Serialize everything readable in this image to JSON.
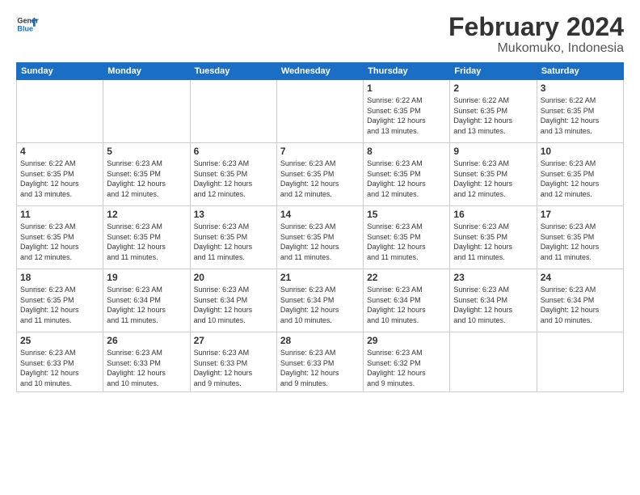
{
  "header": {
    "logo_line1": "General",
    "logo_line2": "Blue",
    "title": "February 2024",
    "subtitle": "Mukomuko, Indonesia"
  },
  "weekdays": [
    "Sunday",
    "Monday",
    "Tuesday",
    "Wednesday",
    "Thursday",
    "Friday",
    "Saturday"
  ],
  "weeks": [
    [
      {
        "day": "",
        "info": ""
      },
      {
        "day": "",
        "info": ""
      },
      {
        "day": "",
        "info": ""
      },
      {
        "day": "",
        "info": ""
      },
      {
        "day": "1",
        "info": "Sunrise: 6:22 AM\nSunset: 6:35 PM\nDaylight: 12 hours\nand 13 minutes."
      },
      {
        "day": "2",
        "info": "Sunrise: 6:22 AM\nSunset: 6:35 PM\nDaylight: 12 hours\nand 13 minutes."
      },
      {
        "day": "3",
        "info": "Sunrise: 6:22 AM\nSunset: 6:35 PM\nDaylight: 12 hours\nand 13 minutes."
      }
    ],
    [
      {
        "day": "4",
        "info": "Sunrise: 6:22 AM\nSunset: 6:35 PM\nDaylight: 12 hours\nand 13 minutes."
      },
      {
        "day": "5",
        "info": "Sunrise: 6:23 AM\nSunset: 6:35 PM\nDaylight: 12 hours\nand 12 minutes."
      },
      {
        "day": "6",
        "info": "Sunrise: 6:23 AM\nSunset: 6:35 PM\nDaylight: 12 hours\nand 12 minutes."
      },
      {
        "day": "7",
        "info": "Sunrise: 6:23 AM\nSunset: 6:35 PM\nDaylight: 12 hours\nand 12 minutes."
      },
      {
        "day": "8",
        "info": "Sunrise: 6:23 AM\nSunset: 6:35 PM\nDaylight: 12 hours\nand 12 minutes."
      },
      {
        "day": "9",
        "info": "Sunrise: 6:23 AM\nSunset: 6:35 PM\nDaylight: 12 hours\nand 12 minutes."
      },
      {
        "day": "10",
        "info": "Sunrise: 6:23 AM\nSunset: 6:35 PM\nDaylight: 12 hours\nand 12 minutes."
      }
    ],
    [
      {
        "day": "11",
        "info": "Sunrise: 6:23 AM\nSunset: 6:35 PM\nDaylight: 12 hours\nand 12 minutes."
      },
      {
        "day": "12",
        "info": "Sunrise: 6:23 AM\nSunset: 6:35 PM\nDaylight: 12 hours\nand 11 minutes."
      },
      {
        "day": "13",
        "info": "Sunrise: 6:23 AM\nSunset: 6:35 PM\nDaylight: 12 hours\nand 11 minutes."
      },
      {
        "day": "14",
        "info": "Sunrise: 6:23 AM\nSunset: 6:35 PM\nDaylight: 12 hours\nand 11 minutes."
      },
      {
        "day": "15",
        "info": "Sunrise: 6:23 AM\nSunset: 6:35 PM\nDaylight: 12 hours\nand 11 minutes."
      },
      {
        "day": "16",
        "info": "Sunrise: 6:23 AM\nSunset: 6:35 PM\nDaylight: 12 hours\nand 11 minutes."
      },
      {
        "day": "17",
        "info": "Sunrise: 6:23 AM\nSunset: 6:35 PM\nDaylight: 12 hours\nand 11 minutes."
      }
    ],
    [
      {
        "day": "18",
        "info": "Sunrise: 6:23 AM\nSunset: 6:35 PM\nDaylight: 12 hours\nand 11 minutes."
      },
      {
        "day": "19",
        "info": "Sunrise: 6:23 AM\nSunset: 6:34 PM\nDaylight: 12 hours\nand 11 minutes."
      },
      {
        "day": "20",
        "info": "Sunrise: 6:23 AM\nSunset: 6:34 PM\nDaylight: 12 hours\nand 10 minutes."
      },
      {
        "day": "21",
        "info": "Sunrise: 6:23 AM\nSunset: 6:34 PM\nDaylight: 12 hours\nand 10 minutes."
      },
      {
        "day": "22",
        "info": "Sunrise: 6:23 AM\nSunset: 6:34 PM\nDaylight: 12 hours\nand 10 minutes."
      },
      {
        "day": "23",
        "info": "Sunrise: 6:23 AM\nSunset: 6:34 PM\nDaylight: 12 hours\nand 10 minutes."
      },
      {
        "day": "24",
        "info": "Sunrise: 6:23 AM\nSunset: 6:34 PM\nDaylight: 12 hours\nand 10 minutes."
      }
    ],
    [
      {
        "day": "25",
        "info": "Sunrise: 6:23 AM\nSunset: 6:33 PM\nDaylight: 12 hours\nand 10 minutes."
      },
      {
        "day": "26",
        "info": "Sunrise: 6:23 AM\nSunset: 6:33 PM\nDaylight: 12 hours\nand 10 minutes."
      },
      {
        "day": "27",
        "info": "Sunrise: 6:23 AM\nSunset: 6:33 PM\nDaylight: 12 hours\nand 9 minutes."
      },
      {
        "day": "28",
        "info": "Sunrise: 6:23 AM\nSunset: 6:33 PM\nDaylight: 12 hours\nand 9 minutes."
      },
      {
        "day": "29",
        "info": "Sunrise: 6:23 AM\nSunset: 6:32 PM\nDaylight: 12 hours\nand 9 minutes."
      },
      {
        "day": "",
        "info": ""
      },
      {
        "day": "",
        "info": ""
      }
    ]
  ]
}
